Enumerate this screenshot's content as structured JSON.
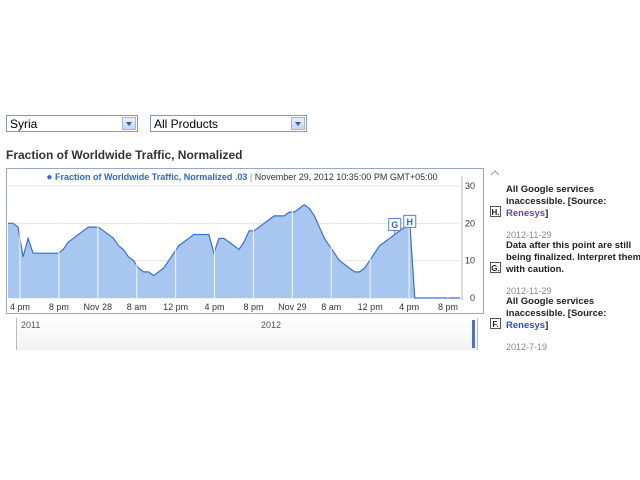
{
  "filters": {
    "country": "Syria",
    "product": "All Products"
  },
  "chart_title": "Fraction of Worldwide Traffic, Normalized",
  "legend": {
    "series": "Fraction of Worldwide Traffic, Normalized",
    "value": ".03",
    "separator": "|",
    "timestamp": "November 29, 2012 10:35:00 PM GMT+05:00"
  },
  "chart_data": {
    "type": "area",
    "title": "",
    "xlabel": "",
    "ylabel": "",
    "ylim": [
      0,
      30
    ],
    "y_ticks": [
      "0",
      "10",
      "20",
      "30"
    ],
    "x_ticks": [
      "4 pm",
      "8 pm",
      "Nov 28",
      "8 am",
      "12 pm",
      "4 pm",
      "8 pm",
      "Nov 29",
      "8 am",
      "12 pm",
      "4 pm",
      "8 pm"
    ],
    "grid": true,
    "series": [
      {
        "color": "#3b6fd0",
        "fill": "#a7c7f0",
        "x": [
          0,
          1,
          2,
          3,
          4,
          5,
          6,
          7,
          8,
          9,
          10,
          11,
          12,
          13,
          14,
          15,
          16,
          17,
          18,
          19,
          20,
          21,
          22,
          23,
          24,
          25,
          26,
          27,
          28,
          29,
          30,
          31,
          32,
          33,
          34,
          35,
          36,
          37,
          38,
          39,
          40,
          41,
          42,
          43,
          44,
          45,
          46,
          47,
          48,
          49,
          50,
          51,
          52,
          53,
          54,
          55,
          56,
          57,
          58,
          59,
          60,
          61,
          62,
          63,
          64,
          65,
          66,
          67,
          68,
          69,
          70,
          71,
          72,
          73,
          74,
          75,
          76,
          77,
          78,
          79,
          80,
          81,
          82,
          83,
          84,
          85,
          86,
          87,
          88,
          89,
          90
        ],
        "values": [
          20,
          20,
          19,
          11,
          16,
          12,
          12,
          12,
          12,
          12,
          12,
          13,
          15,
          16,
          17,
          18,
          19,
          19,
          19,
          18,
          17,
          16,
          14,
          13,
          11,
          10,
          8,
          7,
          7,
          6,
          7,
          8,
          10,
          12,
          14,
          15,
          16,
          17,
          17,
          17,
          17,
          12,
          16,
          16,
          15,
          14,
          13,
          15,
          18,
          18,
          19,
          20,
          21,
          22,
          22,
          22,
          23,
          23,
          24,
          25,
          24,
          22,
          19,
          16,
          14,
          12,
          10,
          9,
          8,
          7,
          7,
          8,
          10,
          12,
          14,
          15,
          16,
          17,
          18,
          19,
          20,
          0,
          0,
          0,
          0,
          0,
          0,
          0,
          0,
          0,
          0
        ]
      }
    ],
    "annotation_flags": [
      "G",
      "H"
    ]
  },
  "navigator": {
    "labels": [
      "2011",
      "2012"
    ]
  },
  "annotations": [
    {
      "letter": "H.",
      "text": "All Google services inaccessible. [Source: ",
      "source": "Renesys",
      "text_end": "]",
      "date": "2012-11-29"
    },
    {
      "letter": "G.",
      "text": "Data after this point are still being finalized. Interpret them with caution.",
      "date": "2012-11-29"
    },
    {
      "letter": "F.",
      "text": "All Google services inaccessible. [Source: ",
      "source": "Renesys",
      "text_end": "]",
      "date": "2012-7-19"
    }
  ]
}
